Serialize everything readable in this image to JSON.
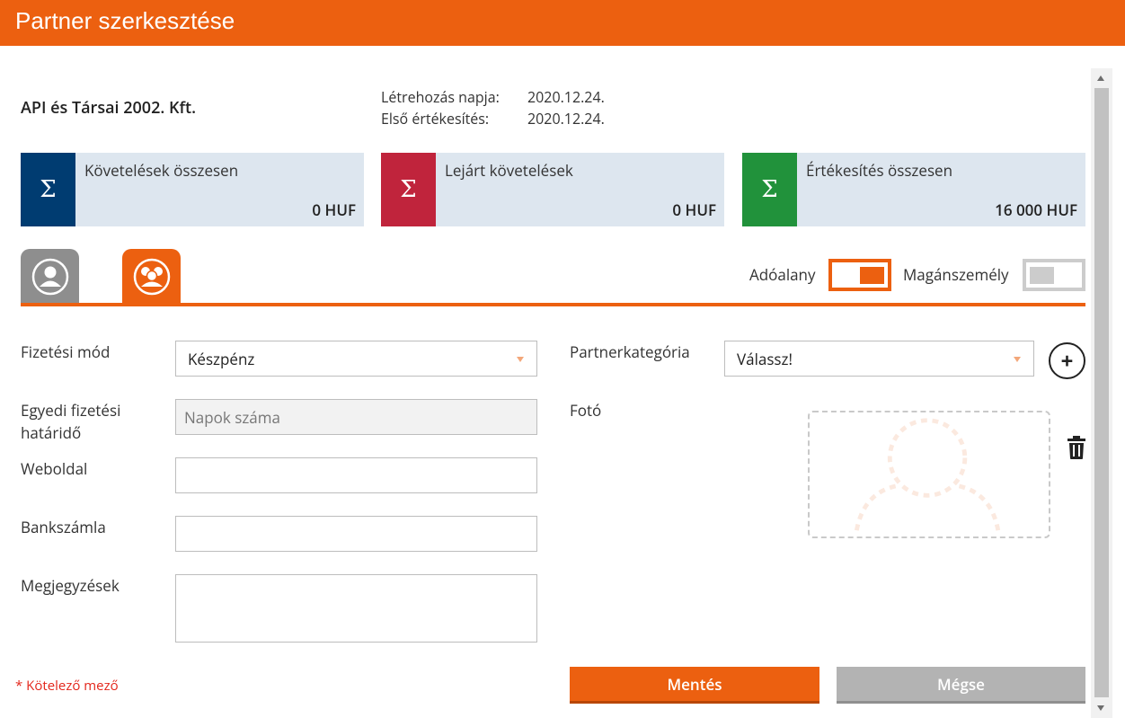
{
  "window": {
    "title": "Partner szerkesztése"
  },
  "header": {
    "company_name": "API és Társai 2002. Kft.",
    "created_label": "Létrehozás napja:",
    "created_value": "2020.12.24.",
    "first_sale_label": "Első értékesítés:",
    "first_sale_value": "2020.12.24."
  },
  "cards": [
    {
      "label": "Követelések összesen",
      "value": "0 HUF",
      "icon": "Σ",
      "color": "#003c71"
    },
    {
      "label": "Lejárt követelések",
      "value": "0 HUF",
      "icon": "Σ",
      "color": "#c0243c"
    },
    {
      "label": "Értékesítés összesen",
      "value": "16 000 HUF",
      "icon": "Σ",
      "color": "#21923b"
    }
  ],
  "tabs": [
    {
      "icon": "single-user-icon",
      "active": false
    },
    {
      "icon": "user-group-icon",
      "active": true
    }
  ],
  "toggles": {
    "taxpayer_label": "Adóalany",
    "taxpayer_on": true,
    "private_person_label": "Magánszemély",
    "private_person_on": false
  },
  "form": {
    "payment_method_label": "Fizetési mód",
    "payment_method_value": "Készpénz",
    "custom_due_label": "Egyedi fizetési határidő",
    "custom_due_placeholder": "Napok száma",
    "website_label": "Weboldal",
    "website_value": "",
    "bank_account_label": "Bankszámla",
    "bank_account_value": "",
    "notes_label": "Megjegyzések",
    "notes_value": "",
    "partner_category_label": "Partnerkategória",
    "partner_category_value": "Válassz!",
    "photo_label": "Fotó"
  },
  "footer": {
    "required_note": "* Kötelező mező",
    "save_label": "Mentés",
    "cancel_label": "Mégse"
  },
  "colors": {
    "accent": "#ec6010",
    "required": "#e3261b",
    "disabled_button": "#b3b3b3"
  }
}
